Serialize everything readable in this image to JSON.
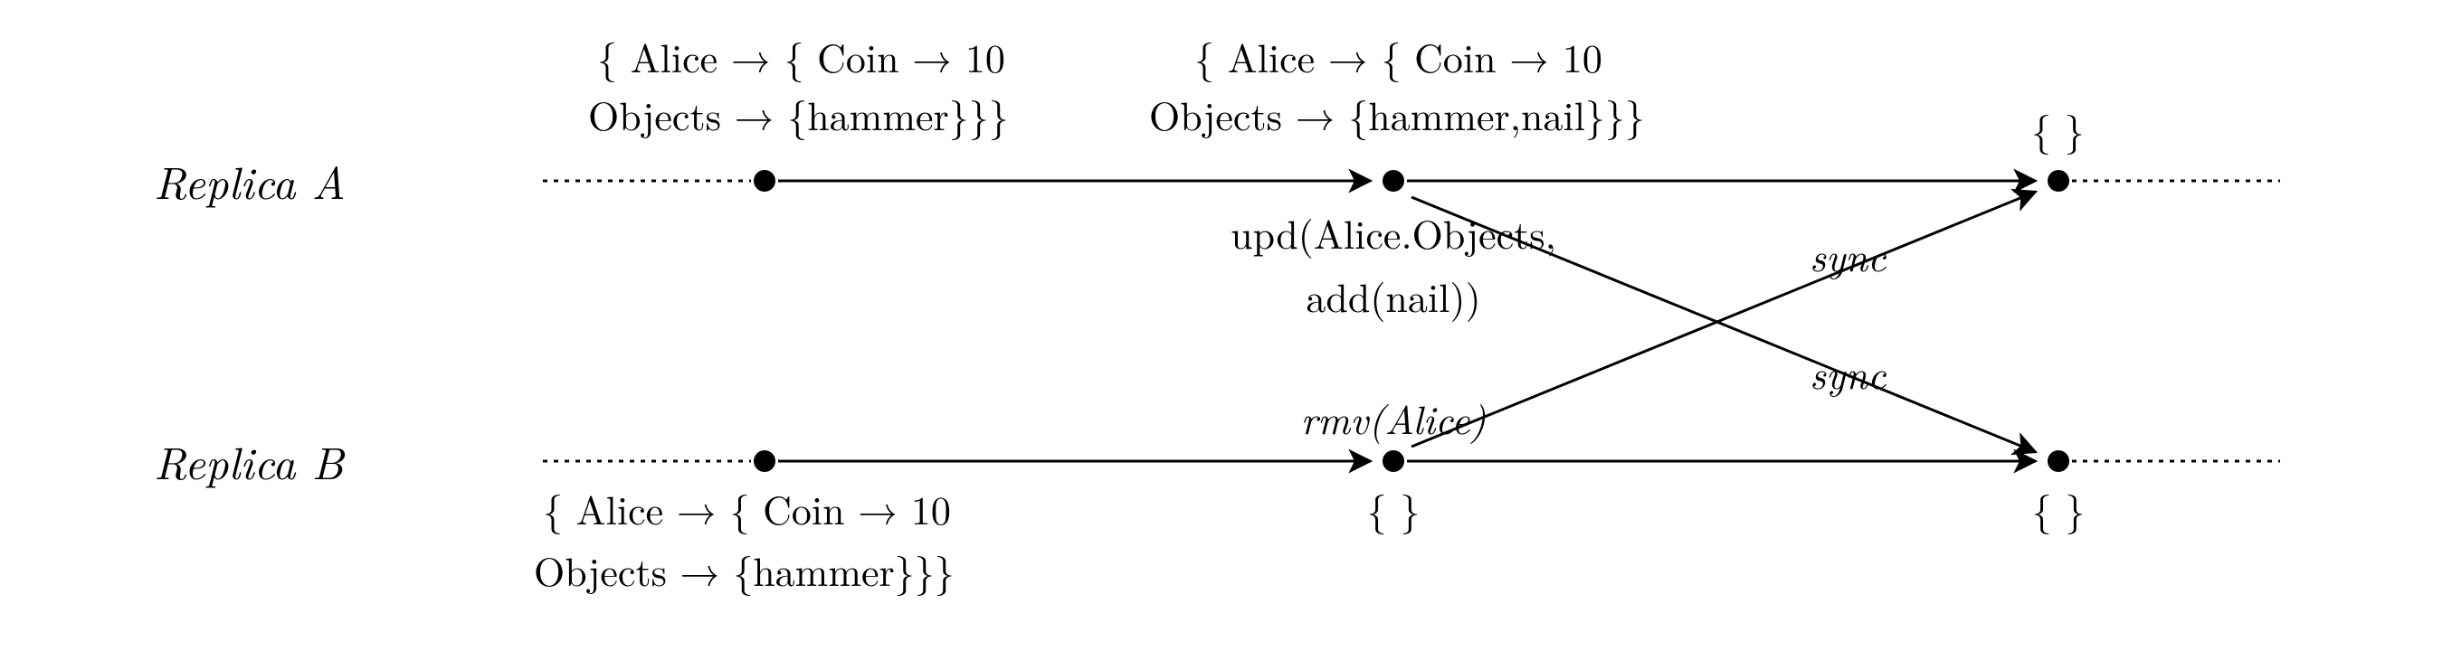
{
  "replicas": {
    "a": {
      "label": "Replica A"
    },
    "b": {
      "label": "Replica B"
    }
  },
  "states": {
    "a1": {
      "line1": "{ Alice → { Coin → 10",
      "line2": "Objects → {hammer}}}"
    },
    "a2": {
      "line1": "{ Alice → { Coin → 10",
      "line2": "Objects → {hammer,nail}}}"
    },
    "a3": {
      "line1": "{ }"
    },
    "b1": {
      "line1": "{ Alice → { Coin → 10",
      "line2": "Objects → {hammer}}}"
    },
    "b2": {
      "line1": "{ }"
    },
    "b3": {
      "line1": "{ }"
    }
  },
  "operations": {
    "a_upd": {
      "line1": "upd(Alice.Objects,",
      "line2": "add(nail))"
    },
    "b_rmv": {
      "label": "rmv(Alice)"
    }
  },
  "sync": {
    "ab": "sync",
    "ba": "sync"
  },
  "chart_data": {
    "type": "diagram",
    "description": "CRDT replica timeline showing a remove-wins map example: concurrent update and remove, then sync, resulting in empty maps on both replicas.",
    "replicas": [
      "Replica A",
      "Replica B"
    ],
    "events": [
      {
        "replica": "A",
        "step": 1,
        "state": "{ Alice -> { Coin -> 10, Objects -> {hammer} } }"
      },
      {
        "replica": "A",
        "step": 2,
        "op": "upd(Alice.Objects, add(nail))",
        "state": "{ Alice -> { Coin -> 10, Objects -> {hammer, nail} } }"
      },
      {
        "replica": "A",
        "step": 3,
        "after_sync": true,
        "state": "{ }"
      },
      {
        "replica": "B",
        "step": 1,
        "state": "{ Alice -> { Coin -> 10, Objects -> {hammer} } }"
      },
      {
        "replica": "B",
        "step": 2,
        "op": "rmv(Alice)",
        "state": "{ }"
      },
      {
        "replica": "B",
        "step": 3,
        "after_sync": true,
        "state": "{ }"
      }
    ],
    "sync_edges": [
      {
        "from": "A@2",
        "to": "B@3",
        "label": "sync"
      },
      {
        "from": "B@2",
        "to": "A@3",
        "label": "sync"
      }
    ]
  }
}
